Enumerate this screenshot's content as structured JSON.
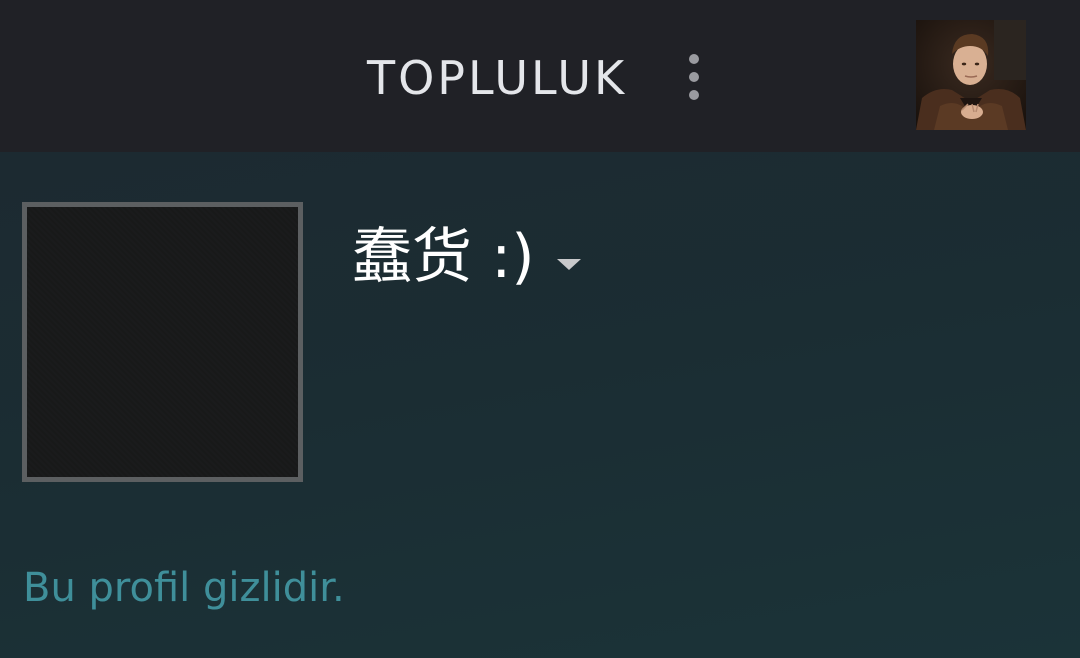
{
  "header": {
    "title": "TOPLULUK",
    "menu_icon": "more-vertical-icon",
    "avatar_icon": "user-avatar-photo"
  },
  "profile": {
    "name": "蠢货 :)",
    "dropdown_icon": "caret-down-icon",
    "avatar_icon": "default-profile-avatar",
    "private_message": "Bu profil gizlidir."
  },
  "colors": {
    "header_bg": "#202126",
    "page_bg": "#1b2a30",
    "private_text": "#3f8f9a",
    "avatar_border": "#5c5f61"
  }
}
